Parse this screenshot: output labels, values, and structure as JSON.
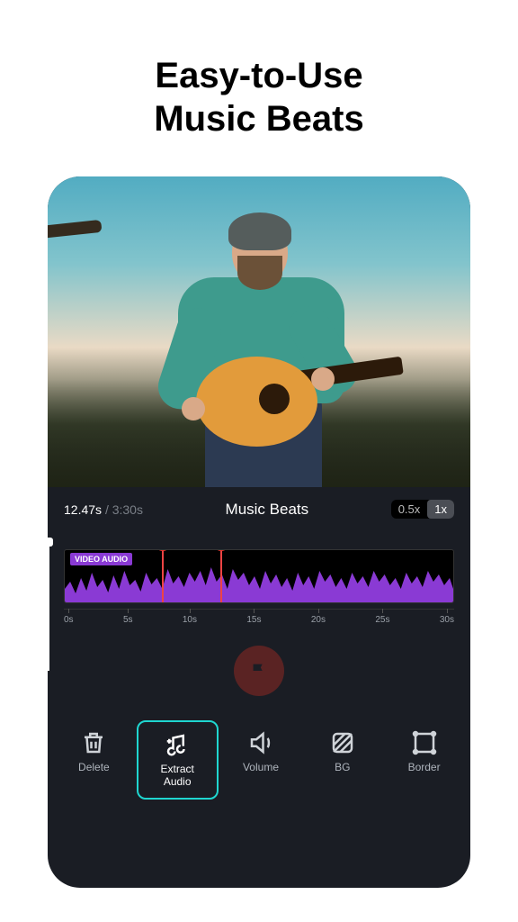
{
  "headline": "Easy-to-Use\nMusic Beats",
  "time": {
    "current": "12.47s",
    "total": "3:30s"
  },
  "mode_title": "Music Beats",
  "speed": {
    "options": [
      "0.5x",
      "1x"
    ],
    "active": "1x"
  },
  "track": {
    "label": "VIDEO AUDIO"
  },
  "markers": [
    {
      "num": "1",
      "position_pct": 25
    },
    {
      "num": "2",
      "position_pct": 40
    }
  ],
  "playhead_pct": 41,
  "ruler": [
    "0s",
    "5s",
    "10s",
    "15s",
    "20s",
    "25s",
    "30s"
  ],
  "flag_button": "flag",
  "toolbar": [
    {
      "id": "delete",
      "label": "Delete",
      "icon": "trash-icon",
      "selected": false
    },
    {
      "id": "extract",
      "label": "Extract\nAudio",
      "icon": "music-plus-icon",
      "selected": true
    },
    {
      "id": "volume",
      "label": "Volume",
      "icon": "speaker-icon",
      "selected": false
    },
    {
      "id": "bg",
      "label": "BG",
      "icon": "hatch-icon",
      "selected": false
    },
    {
      "id": "border",
      "label": "Border",
      "icon": "frame-icon",
      "selected": false
    }
  ]
}
